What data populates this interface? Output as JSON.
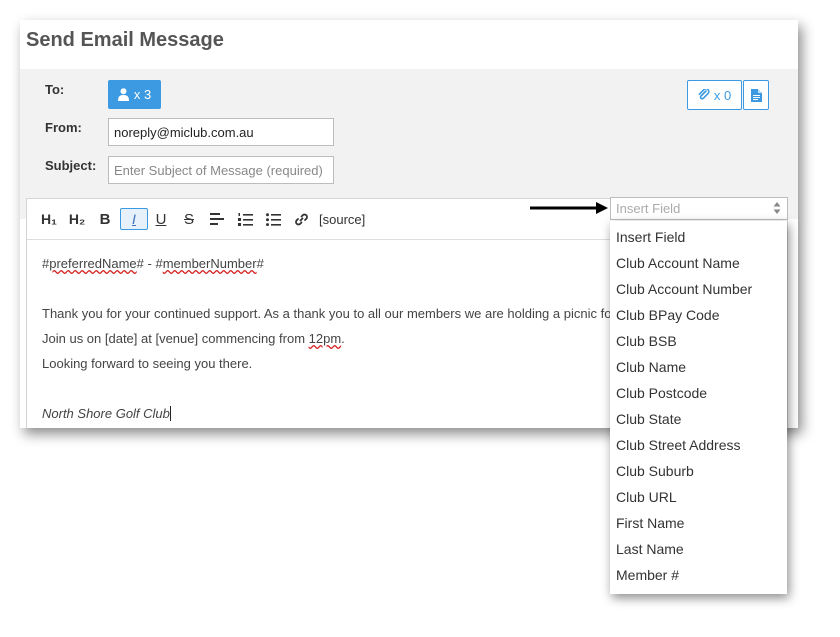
{
  "dialog": {
    "title": "Send Email Message"
  },
  "form": {
    "to_label": "To:",
    "to_button": "x 3",
    "from_label": "From:",
    "from_value": "noreply@miclub.com.au",
    "subject_label": "Subject:",
    "subject_placeholder": "Enter Subject of Message (required)",
    "attachments_button": "x 0"
  },
  "toolbar": {
    "h1": "H₁",
    "h2": "H₂",
    "bold": "B",
    "italic": "I",
    "underline": "U",
    "strike": "S",
    "source": "[source]"
  },
  "message": {
    "line1_hash_a": "#",
    "line1_pref": "preferredName",
    "line1_mid": "# - #",
    "line1_member": "memberNumber",
    "line1_hash_b": "#",
    "line2": "Thank you for your continued support. As a thank you to all our members we are holding a picnic fo",
    "line3_a": "Join us on [date] at [venue] commencing from ",
    "line3_time": "12pm",
    "line3_end": ".",
    "line4": "Looking forward to seeing you there.",
    "signature": "North Shore Golf Club"
  },
  "insert_field": {
    "placeholder": "Insert Field",
    "options": [
      "Insert Field",
      "Club Account Name",
      "Club Account Number",
      "Club BPay Code",
      "Club BSB",
      "Club Name",
      "Club Postcode",
      "Club State",
      "Club Street Address",
      "Club Suburb",
      "Club URL",
      "First Name",
      "Last Name",
      "Member #"
    ]
  },
  "colors": {
    "accent": "#3b9ae1",
    "form_bg": "#f2f2f2",
    "spell_underline": "#d62020"
  }
}
